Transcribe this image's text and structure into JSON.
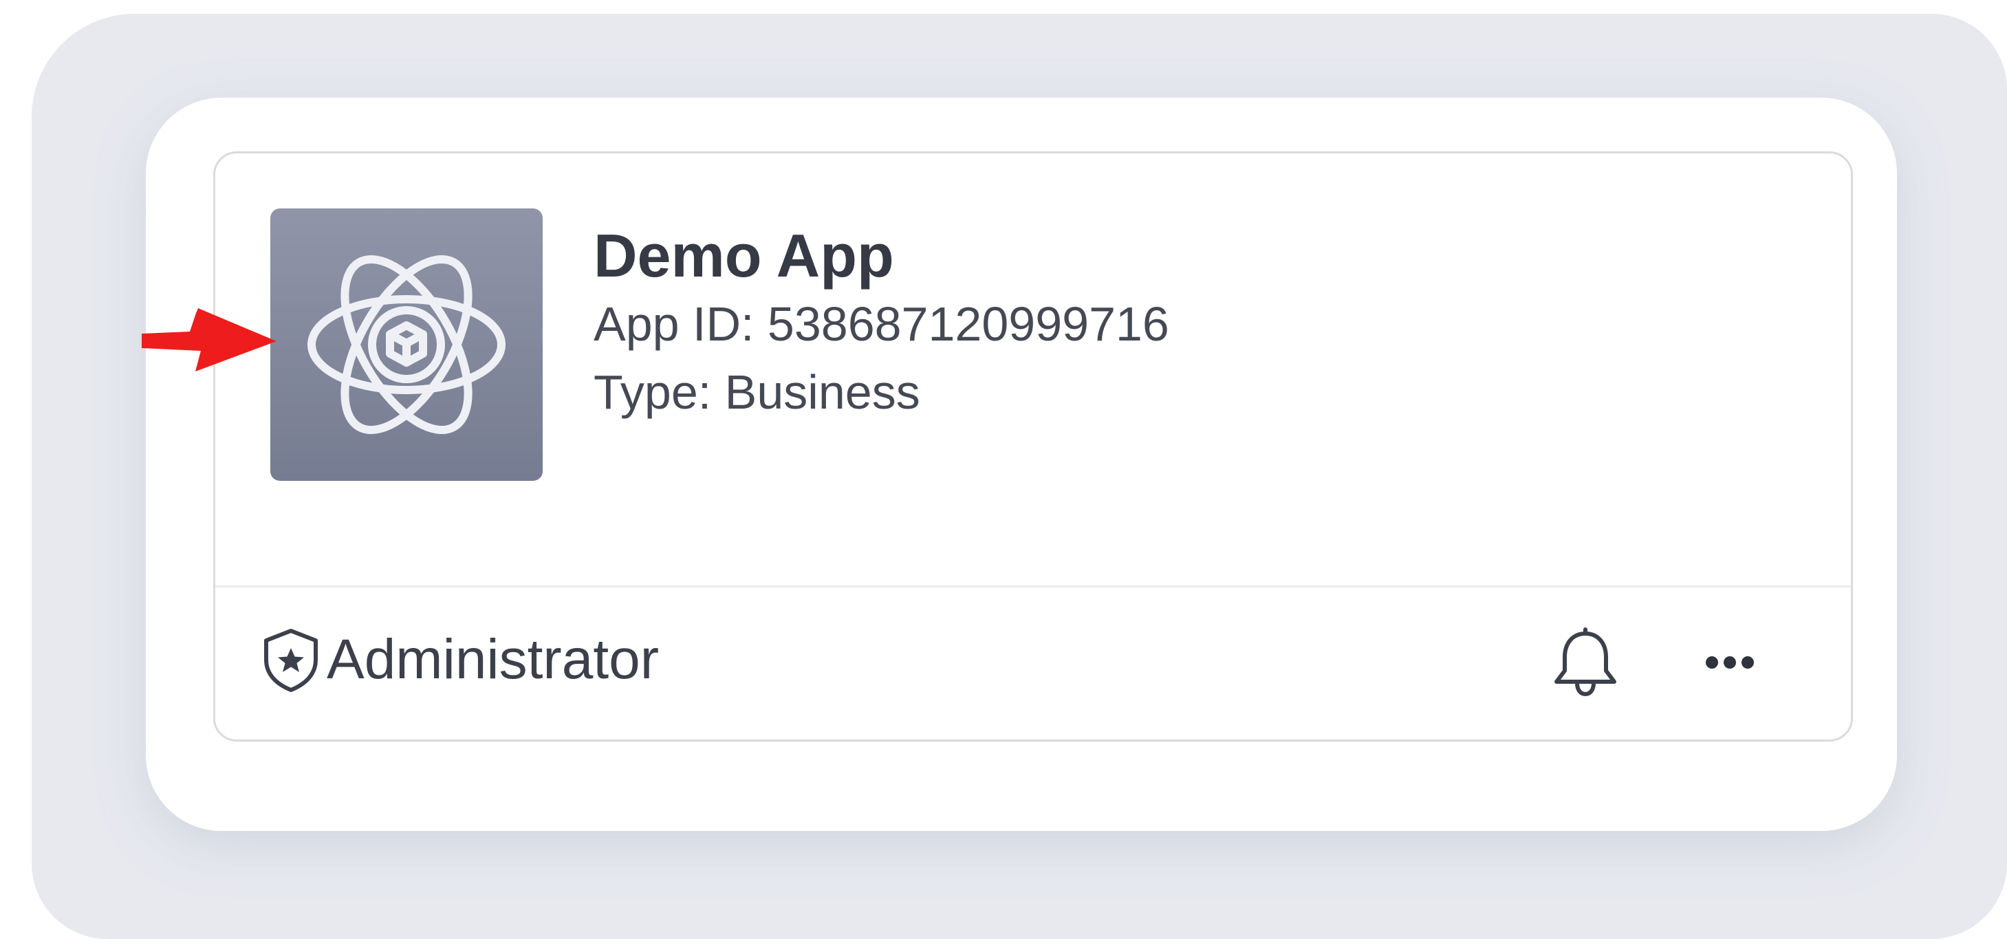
{
  "app_card": {
    "name": "Demo App",
    "app_id": "App ID: 538687120999716",
    "type": "Type: Business",
    "icon": "atom-cube-icon"
  },
  "footer": {
    "role_label": "Administrator",
    "role_icon": "shield-star-icon",
    "notifications_icon": "bell-icon",
    "more_icon": "more-horizontal-icon"
  },
  "annotation": {
    "icon": "red-arrow-icon",
    "color": "#ee1c1c"
  },
  "colors": {
    "backdrop": "#e7e9ef",
    "icon_tile_top": "#9095a8",
    "icon_tile_bottom": "#767c91",
    "text_primary": "#363a45",
    "card_border": "#d9dbe0"
  }
}
